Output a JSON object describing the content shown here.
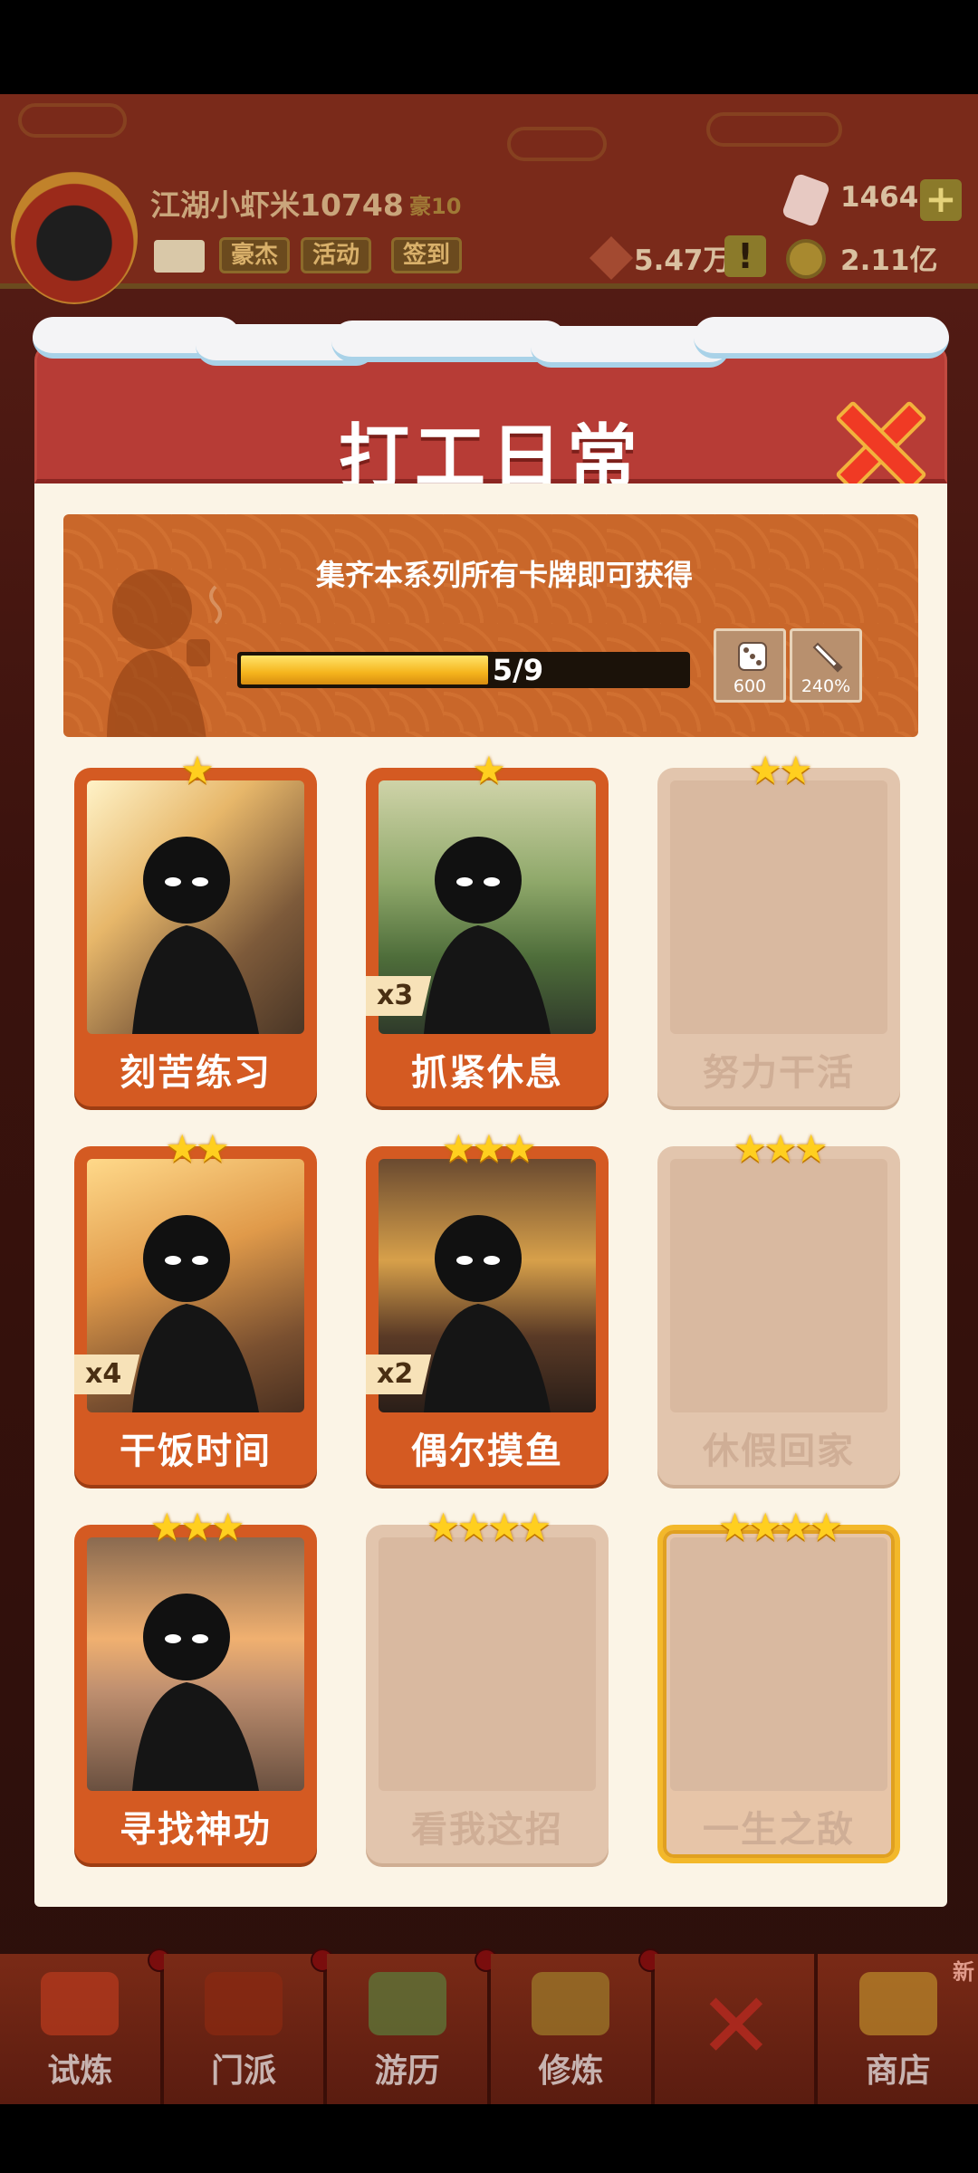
{
  "player": {
    "name": "江湖小虾米10748",
    "vip": "豪10",
    "chips": [
      "豪杰",
      "活动",
      "签到"
    ],
    "gems": "1464",
    "tickets": "5.47万",
    "coins": "2.11亿",
    "plus": "+",
    "warn": "!"
  },
  "dialog": {
    "title": "打工日常",
    "banner_text": "集齐本系列所有卡牌即可获得",
    "progress": {
      "current": 5,
      "total": 9,
      "label": "5/9"
    },
    "rewards": [
      {
        "icon": "dice-icon",
        "value": "600"
      },
      {
        "icon": "sword-icon",
        "value": "240%"
      }
    ]
  },
  "cards": [
    {
      "name": "刻苦练习",
      "stars": "★",
      "owned": true,
      "count": ""
    },
    {
      "name": "抓紧休息",
      "stars": "★",
      "owned": true,
      "count": "x3"
    },
    {
      "name": "努力干活",
      "stars": "★★",
      "owned": false,
      "count": ""
    },
    {
      "name": "干饭时间",
      "stars": "★★",
      "owned": true,
      "count": "x4"
    },
    {
      "name": "偶尔摸鱼",
      "stars": "★★★",
      "owned": true,
      "count": "x2"
    },
    {
      "name": "休假回家",
      "stars": "★★★",
      "owned": false,
      "count": ""
    },
    {
      "name": "寻找神功",
      "stars": "★★★",
      "owned": true,
      "count": ""
    },
    {
      "name": "看我这招",
      "stars": "★★★★",
      "owned": false,
      "count": ""
    },
    {
      "name": "一生之敌",
      "stars": "★★★★",
      "owned": false,
      "count": ""
    }
  ],
  "nav": [
    {
      "label": "试炼"
    },
    {
      "label": "门派"
    },
    {
      "label": "游历"
    },
    {
      "label": "修炼"
    },
    {
      "label": ""
    },
    {
      "label": "商店",
      "badge": "新"
    }
  ],
  "colors": {
    "accent": "#d45a22",
    "header": "#b73c36",
    "gold": "#ffcf1f",
    "close": "#f03a24"
  }
}
